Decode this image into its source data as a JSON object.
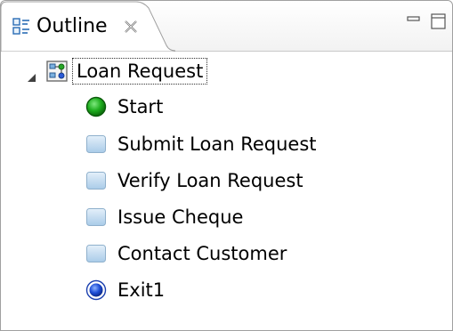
{
  "tab": {
    "title": "Outline",
    "icon": "outline-icon",
    "close_icon": "close-icon"
  },
  "window_controls": {
    "minimize_icon": "minimize-icon",
    "maximize_icon": "maximize-icon"
  },
  "tree": {
    "root": {
      "label": "Loan Request",
      "icon": "process-diagram-icon",
      "expanded": true
    },
    "nodes": [
      {
        "label": "Start",
        "icon": "start-event-icon",
        "kind": "start-event",
        "color": "#1a9a1a"
      },
      {
        "label": "Submit Loan Request",
        "icon": "task-icon",
        "kind": "task",
        "color": "#c5dcf0"
      },
      {
        "label": "Verify Loan Request",
        "icon": "task-icon",
        "kind": "task",
        "color": "#c5dcf0"
      },
      {
        "label": "Issue Cheque",
        "icon": "task-icon",
        "kind": "task",
        "color": "#c5dcf0"
      },
      {
        "label": "Contact Customer",
        "icon": "task-icon",
        "kind": "task",
        "color": "#c5dcf0"
      },
      {
        "label": "Exit1",
        "icon": "end-event-icon",
        "kind": "end-event",
        "color": "#1f4fd8"
      }
    ]
  }
}
